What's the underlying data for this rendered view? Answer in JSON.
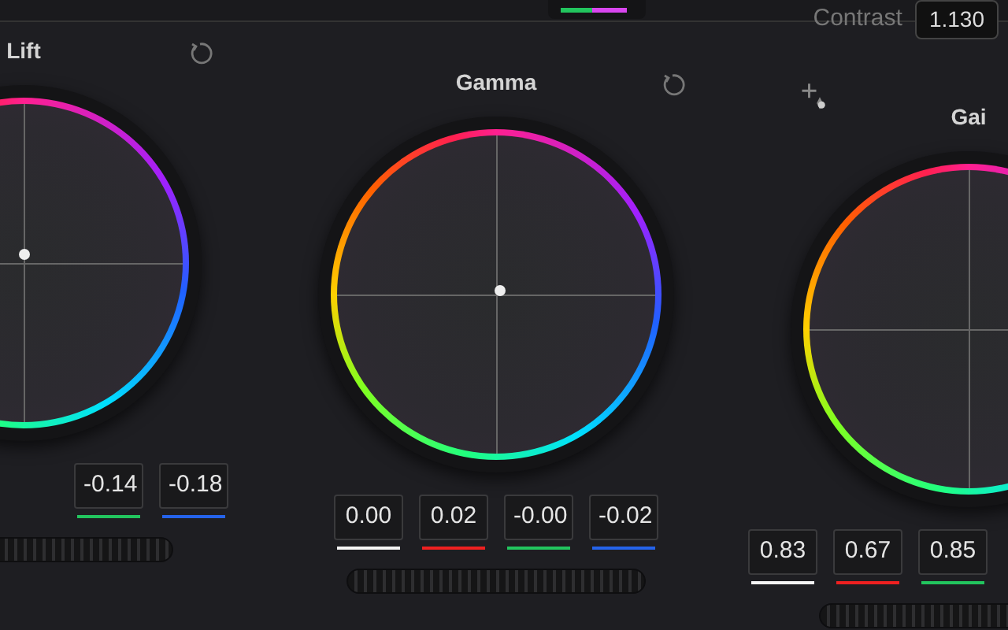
{
  "top_bar": {
    "contrast_label": "Contrast",
    "contrast_value": "1.130"
  },
  "wheels": [
    {
      "label": "Lift",
      "values": [
        {
          "text": "-0.14",
          "color": "#22c55e"
        },
        {
          "text": "-0.18",
          "color": "#2563eb"
        }
      ]
    },
    {
      "label": "Gamma",
      "values": [
        {
          "text": "0.00",
          "color": "#f5f5f5"
        },
        {
          "text": "0.02",
          "color": "#ef2020"
        },
        {
          "text": "-0.00",
          "color": "#22c55e"
        },
        {
          "text": "-0.02",
          "color": "#2563eb"
        }
      ]
    },
    {
      "label": "Gai",
      "values": [
        {
          "text": "0.83",
          "color": "#f5f5f5"
        },
        {
          "text": "0.67",
          "color": "#ef2020"
        },
        {
          "text": "0.85",
          "color": "#22c55e"
        }
      ]
    }
  ]
}
